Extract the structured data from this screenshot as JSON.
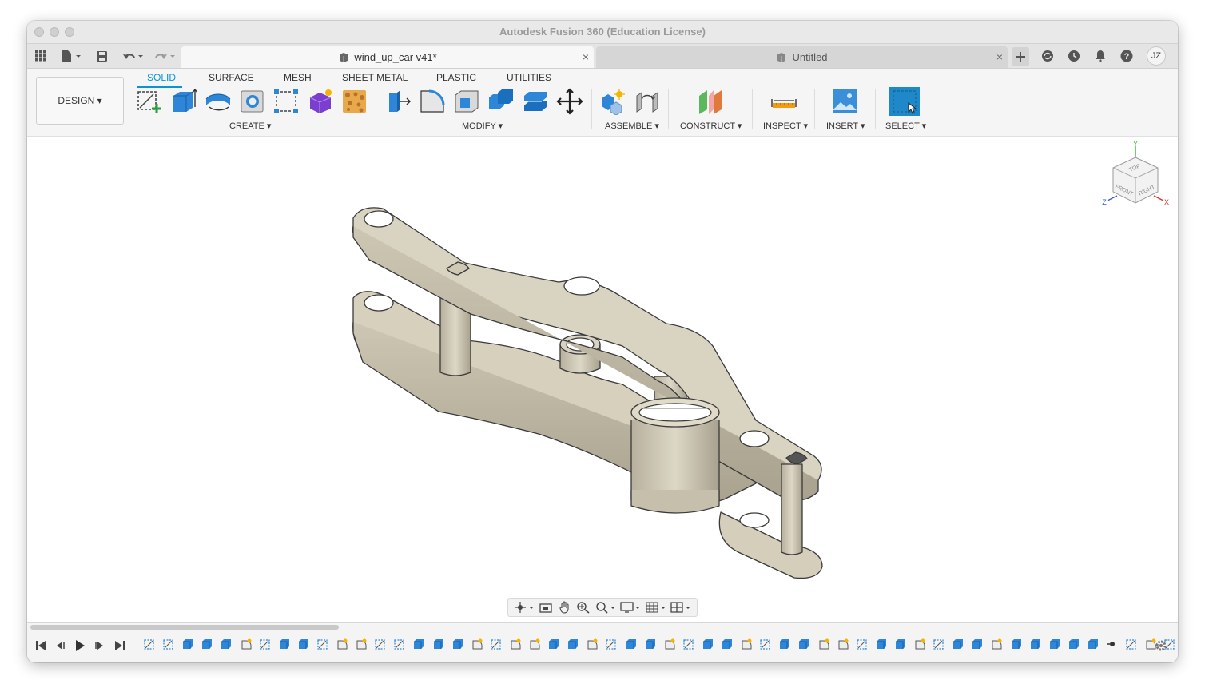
{
  "window": {
    "title": "Autodesk Fusion 360 (Education License)"
  },
  "tabs": {
    "active": {
      "label": "wind_up_car v41*",
      "close": "×"
    },
    "inactive": {
      "label": "Untitled",
      "close": "×"
    }
  },
  "account": {
    "initials": "JZ"
  },
  "ribbon": {
    "workspace": "DESIGN ▾",
    "tabs": [
      "SOLID",
      "SURFACE",
      "MESH",
      "SHEET METAL",
      "PLASTIC",
      "UTILITIES"
    ],
    "groups": {
      "create": "CREATE ▾",
      "modify": "MODIFY ▾",
      "assemble": "ASSEMBLE ▾",
      "construct": "CONSTRUCT ▾",
      "inspect": "INSPECT ▾",
      "insert": "INSERT ▾",
      "select": "SELECT ▾"
    }
  },
  "viewcube": {
    "top": "TOP",
    "front": "FRONT",
    "right": "RIGHT",
    "axis_x": "X",
    "axis_y": "Y",
    "axis_z": "Z"
  },
  "colors": {
    "accent": "#0696d7",
    "model": "#d8d2c0",
    "model_edge": "#3a3a3a",
    "select_blue": "#1e88c8"
  },
  "icons": {
    "toolbar": [
      "grid-apps-icon",
      "file-icon",
      "save-icon",
      "undo-icon",
      "redo-icon"
    ],
    "right": [
      "new-tab-icon",
      "sync-icon",
      "job-status-icon",
      "notification-icon",
      "help-icon"
    ]
  }
}
